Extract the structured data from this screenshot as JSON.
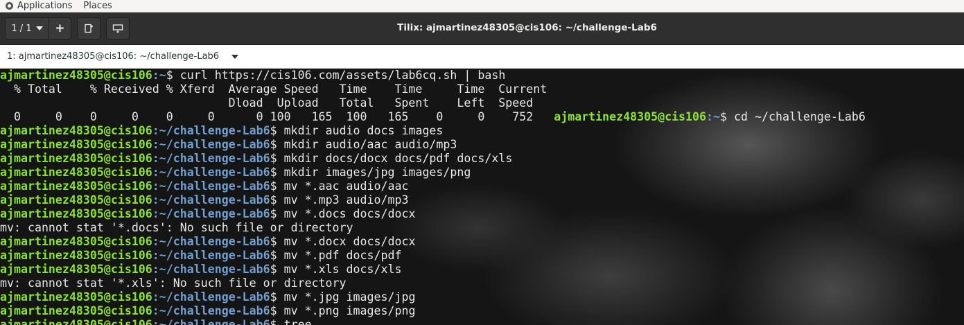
{
  "panel": {
    "applications": "Applications",
    "places": "Places"
  },
  "header": {
    "session_label": "1 / 1",
    "add_label": "+",
    "title": "Tilix: ajmartinez48305@cis106: ~/challenge-Lab6"
  },
  "term_title": "1: ajmartinez48305@cis106: ~/challenge-Lab6",
  "prompt": {
    "user": "ajmartinez48305@cis106",
    "sep": ":",
    "home_path": "~",
    "lab_path": "~/challenge-Lab6",
    "dollar": "$ "
  },
  "lines": {
    "l0_cmd": "curl https://cis106.com/assets/lab6cq.sh | bash",
    "l1": "  % Total    % Received % Xferd  Average Speed   Time    Time     Time  Current",
    "l2": "                                 Dload  Upload   Total   Spent    Left  Speed",
    "l3_out": "  0     0    0     0    0     0      0 100   165  100   165    0     0    752   ",
    "l3_cmd": "cd ~/challenge-Lab6",
    "l4_cmd": "mkdir audio docs images",
    "l5_cmd": "mkdir audio/aac audio/mp3",
    "l6_cmd": "mkdir docs/docx docs/pdf docs/xls",
    "l7_cmd": "mkdir images/jpg images/png",
    "l8_cmd": "mv *.aac audio/aac",
    "l9_cmd": "mv *.mp3 audio/mp3",
    "l10_cmd": "mv *.docs docs/docx",
    "l11": "mv: cannot stat '*.docs': No such file or directory",
    "l12_cmd": "mv *.docx docs/docx",
    "l13_cmd": "mv *.pdf docs/pdf",
    "l14_cmd": "mv *.xls docs/xls",
    "l15": "mv: cannot stat '*.xls': No such file or directory",
    "l16_cmd": "mv *.jpg images/jpg",
    "l17_cmd": "mv *.png images/png",
    "l18_cmd": "tree"
  },
  "colors": {
    "user": "#8ae234",
    "path": "#729fcf",
    "text": "#e8e8e8"
  },
  "icons": {
    "apps": "applications-icon",
    "new_session": "new-session-icon",
    "add_terminal": "add-terminal-icon",
    "dropdown": "chevron-down-icon"
  }
}
